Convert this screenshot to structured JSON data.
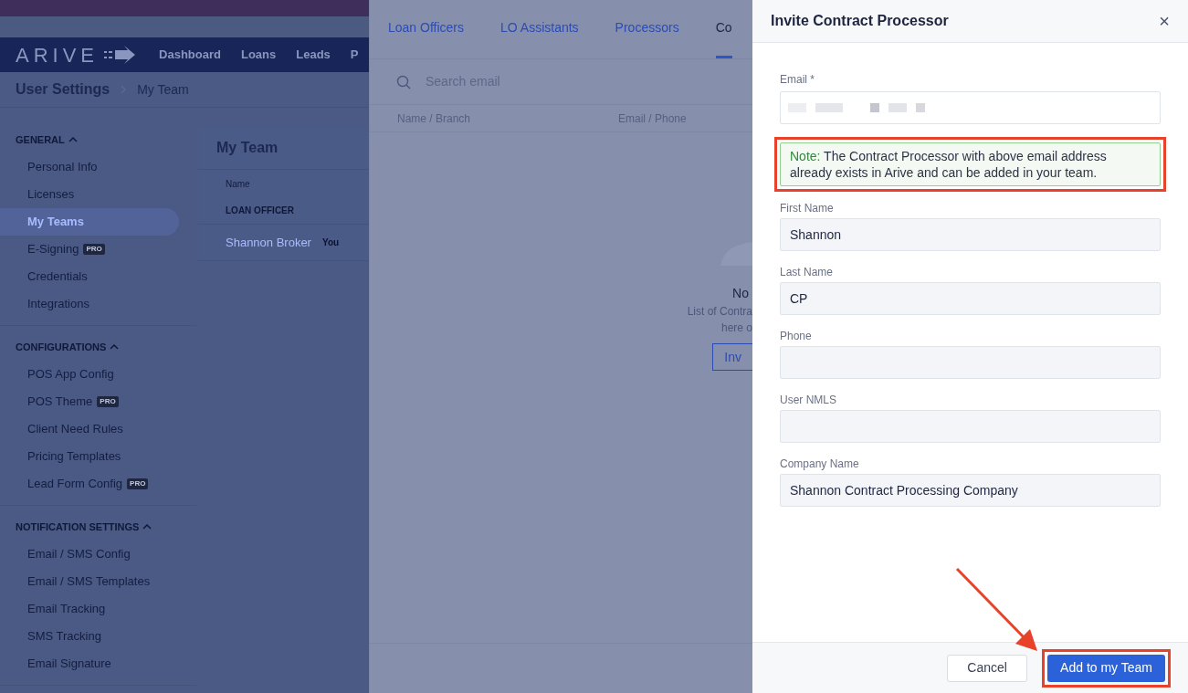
{
  "app": {
    "logo": "ARIVE",
    "nav": [
      "Dashboard",
      "Loans",
      "Leads",
      "P"
    ],
    "breadcrumb": [
      "User Settings",
      "My Team"
    ]
  },
  "sidebar": {
    "sections": [
      {
        "title": "GENERAL",
        "expanded": true,
        "items": [
          {
            "label": "Personal Info",
            "selected": false
          },
          {
            "label": "Licenses",
            "selected": false
          },
          {
            "label": "My Teams",
            "selected": true
          },
          {
            "label": "E-Signing",
            "selected": false,
            "badge": "PRO"
          },
          {
            "label": "Credentials",
            "selected": false
          },
          {
            "label": "Integrations",
            "selected": false
          }
        ]
      },
      {
        "title": "CONFIGURATIONS",
        "expanded": true,
        "items": [
          {
            "label": "POS App Config",
            "selected": false
          },
          {
            "label": "POS Theme",
            "selected": false,
            "badge": "PRO"
          },
          {
            "label": "Client Need Rules",
            "selected": false
          },
          {
            "label": "Pricing Templates",
            "selected": false
          },
          {
            "label": "Lead Form Config",
            "selected": false,
            "badge": "PRO"
          }
        ]
      },
      {
        "title": "NOTIFICATION SETTINGS",
        "expanded": true,
        "items": [
          {
            "label": "Email / SMS Config",
            "selected": false
          },
          {
            "label": "Email / SMS Templates",
            "selected": false
          },
          {
            "label": "Email Tracking",
            "selected": false
          },
          {
            "label": "SMS Tracking",
            "selected": false
          },
          {
            "label": "Email Signature",
            "selected": false
          }
        ]
      }
    ]
  },
  "team_panel": {
    "title": "My Team",
    "column": "Name",
    "group": "LOAN OFFICER",
    "member": {
      "name": "Shannon Broker",
      "tag": "You"
    }
  },
  "team_drawer": {
    "tabs": [
      {
        "label": "Loan Officers",
        "selected": false
      },
      {
        "label": "LO Assistants",
        "selected": false
      },
      {
        "label": "Processors",
        "selected": false
      },
      {
        "label": "Co",
        "selected": true
      }
    ],
    "search": {
      "placeholder": "Search email"
    },
    "columns": [
      "Name / Branch",
      "Email / Phone"
    ],
    "empty": {
      "title": "No",
      "text": [
        "List of Contra",
        "here o"
      ],
      "button": "Inv"
    }
  },
  "dialog": {
    "title": "Invite Contract Processor",
    "close": "×",
    "email": {
      "label": "Email *"
    },
    "note": {
      "lead": "Note:",
      "text": "The Contract Processor with above email address already exists in Arive and can be added in your team.",
      "highlighted": true
    },
    "fields": [
      {
        "label": "First Name",
        "value": "Shannon"
      },
      {
        "label": "Last Name",
        "value": "CP"
      },
      {
        "label": "Phone"
      },
      {
        "label": "User NMLS"
      },
      {
        "label": "Company Name",
        "value": "Shannon Contract Processing Company"
      }
    ],
    "buttons": [
      {
        "label": "Cancel",
        "kind": "secondary",
        "highlighted": false
      },
      {
        "label": "Add to my Team",
        "kind": "primary",
        "highlighted": true
      }
    ]
  }
}
